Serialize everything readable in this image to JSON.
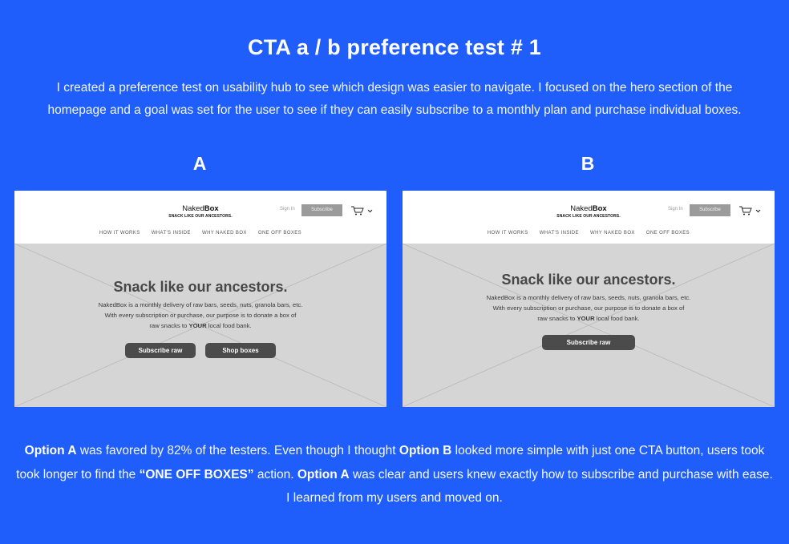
{
  "title": "CTA a / b preference test # 1",
  "intro": "I created a preference test on usability hub to see which design was easier to navigate. I focused on the hero section of the homepage and a goal was set for the user to see if they can easily subscribe to a monthly plan and purchase individual boxes.",
  "variants": {
    "a": {
      "label": "A",
      "brand_light": "Naked",
      "brand_bold": "Box",
      "tagline": "SNACK LIKE OUR ANCESTORS.",
      "signin": "Sign In",
      "subscribe": "Subscribe",
      "nav": [
        "HOW IT WORKS",
        "WHAT'S INSIDE",
        "WHY NAKED BOX",
        "ONE OFF BOXES"
      ],
      "hero_title": "Snack like our ancestors.",
      "hero_line1": "NakedBox is a monthly delivery of  raw bars, seeds, nuts, granola bars, etc.",
      "hero_line2": "With every subscription or purchase, our purpose is to donate a box of",
      "hero_line3_pre": "raw snacks to ",
      "hero_line3_bold": "YOUR",
      "hero_line3_post": " local food bank.",
      "cta_primary": "Subscribe raw",
      "cta_secondary": "Shop boxes"
    },
    "b": {
      "label": "B",
      "brand_light": "Naked",
      "brand_bold": "Box",
      "tagline": "SNACK LIKE OUR ANCESTORS.",
      "signin": "Sign In",
      "subscribe": "Subscribe",
      "nav": [
        "HOW IT WORKS",
        "WHAT'S INSIDE",
        "WHY NAKED BOX",
        "ONE OFF BOXES"
      ],
      "hero_title": "Snack like our ancestors.",
      "hero_line1": "NakedBox is a monthly delivery of  raw bars, seeds, nuts, granola bars, etc.",
      "hero_line2": "With every subscription or purchase, our purpose is to donate a box of",
      "hero_line3_pre": "raw snacks to ",
      "hero_line3_bold": "YOUR",
      "hero_line3_post": " local food bank.",
      "cta_primary": "Subscribe raw"
    }
  },
  "summary": {
    "s1_bold": "Option A",
    "s1": " was favored by 82% of the testers. Even though I thought ",
    "s2_bold": "Option B",
    "s2": " looked more simple with just one CTA button, users took took longer to find the ",
    "s3_bold": "“ONE OFF BOXES”",
    "s3": " action. ",
    "s4_bold": "Option A",
    "s4": " was clear and users knew exactly how to subscribe and purchase with ease. I learned from my users and moved on."
  },
  "colors": {
    "background": "#1f5efb",
    "hero_placeholder": "#d5d5d5",
    "cta_button": "#4b4b4b",
    "header_subscribe": "#9b9b9b"
  },
  "icons": [
    "cart-icon",
    "chevron-down-icon"
  ]
}
